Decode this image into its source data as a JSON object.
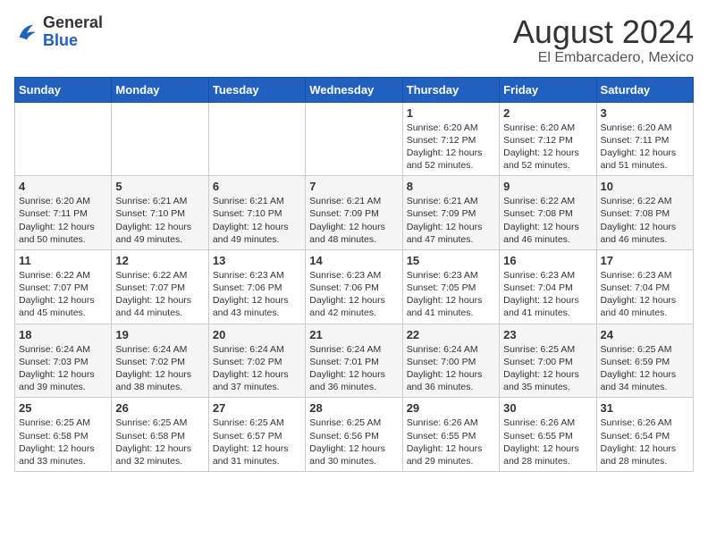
{
  "header": {
    "logo_general": "General",
    "logo_blue": "Blue",
    "month_year": "August 2024",
    "location": "El Embarcadero, Mexico"
  },
  "weekdays": [
    "Sunday",
    "Monday",
    "Tuesday",
    "Wednesday",
    "Thursday",
    "Friday",
    "Saturday"
  ],
  "weeks": [
    [
      {
        "day": "",
        "content": ""
      },
      {
        "day": "",
        "content": ""
      },
      {
        "day": "",
        "content": ""
      },
      {
        "day": "",
        "content": ""
      },
      {
        "day": "1",
        "content": "Sunrise: 6:20 AM\nSunset: 7:12 PM\nDaylight: 12 hours\nand 52 minutes."
      },
      {
        "day": "2",
        "content": "Sunrise: 6:20 AM\nSunset: 7:12 PM\nDaylight: 12 hours\nand 52 minutes."
      },
      {
        "day": "3",
        "content": "Sunrise: 6:20 AM\nSunset: 7:11 PM\nDaylight: 12 hours\nand 51 minutes."
      }
    ],
    [
      {
        "day": "4",
        "content": "Sunrise: 6:20 AM\nSunset: 7:11 PM\nDaylight: 12 hours\nand 50 minutes."
      },
      {
        "day": "5",
        "content": "Sunrise: 6:21 AM\nSunset: 7:10 PM\nDaylight: 12 hours\nand 49 minutes."
      },
      {
        "day": "6",
        "content": "Sunrise: 6:21 AM\nSunset: 7:10 PM\nDaylight: 12 hours\nand 49 minutes."
      },
      {
        "day": "7",
        "content": "Sunrise: 6:21 AM\nSunset: 7:09 PM\nDaylight: 12 hours\nand 48 minutes."
      },
      {
        "day": "8",
        "content": "Sunrise: 6:21 AM\nSunset: 7:09 PM\nDaylight: 12 hours\nand 47 minutes."
      },
      {
        "day": "9",
        "content": "Sunrise: 6:22 AM\nSunset: 7:08 PM\nDaylight: 12 hours\nand 46 minutes."
      },
      {
        "day": "10",
        "content": "Sunrise: 6:22 AM\nSunset: 7:08 PM\nDaylight: 12 hours\nand 46 minutes."
      }
    ],
    [
      {
        "day": "11",
        "content": "Sunrise: 6:22 AM\nSunset: 7:07 PM\nDaylight: 12 hours\nand 45 minutes."
      },
      {
        "day": "12",
        "content": "Sunrise: 6:22 AM\nSunset: 7:07 PM\nDaylight: 12 hours\nand 44 minutes."
      },
      {
        "day": "13",
        "content": "Sunrise: 6:23 AM\nSunset: 7:06 PM\nDaylight: 12 hours\nand 43 minutes."
      },
      {
        "day": "14",
        "content": "Sunrise: 6:23 AM\nSunset: 7:06 PM\nDaylight: 12 hours\nand 42 minutes."
      },
      {
        "day": "15",
        "content": "Sunrise: 6:23 AM\nSunset: 7:05 PM\nDaylight: 12 hours\nand 41 minutes."
      },
      {
        "day": "16",
        "content": "Sunrise: 6:23 AM\nSunset: 7:04 PM\nDaylight: 12 hours\nand 41 minutes."
      },
      {
        "day": "17",
        "content": "Sunrise: 6:23 AM\nSunset: 7:04 PM\nDaylight: 12 hours\nand 40 minutes."
      }
    ],
    [
      {
        "day": "18",
        "content": "Sunrise: 6:24 AM\nSunset: 7:03 PM\nDaylight: 12 hours\nand 39 minutes."
      },
      {
        "day": "19",
        "content": "Sunrise: 6:24 AM\nSunset: 7:02 PM\nDaylight: 12 hours\nand 38 minutes."
      },
      {
        "day": "20",
        "content": "Sunrise: 6:24 AM\nSunset: 7:02 PM\nDaylight: 12 hours\nand 37 minutes."
      },
      {
        "day": "21",
        "content": "Sunrise: 6:24 AM\nSunset: 7:01 PM\nDaylight: 12 hours\nand 36 minutes."
      },
      {
        "day": "22",
        "content": "Sunrise: 6:24 AM\nSunset: 7:00 PM\nDaylight: 12 hours\nand 36 minutes."
      },
      {
        "day": "23",
        "content": "Sunrise: 6:25 AM\nSunset: 7:00 PM\nDaylight: 12 hours\nand 35 minutes."
      },
      {
        "day": "24",
        "content": "Sunrise: 6:25 AM\nSunset: 6:59 PM\nDaylight: 12 hours\nand 34 minutes."
      }
    ],
    [
      {
        "day": "25",
        "content": "Sunrise: 6:25 AM\nSunset: 6:58 PM\nDaylight: 12 hours\nand 33 minutes."
      },
      {
        "day": "26",
        "content": "Sunrise: 6:25 AM\nSunset: 6:58 PM\nDaylight: 12 hours\nand 32 minutes."
      },
      {
        "day": "27",
        "content": "Sunrise: 6:25 AM\nSunset: 6:57 PM\nDaylight: 12 hours\nand 31 minutes."
      },
      {
        "day": "28",
        "content": "Sunrise: 6:25 AM\nSunset: 6:56 PM\nDaylight: 12 hours\nand 30 minutes."
      },
      {
        "day": "29",
        "content": "Sunrise: 6:26 AM\nSunset: 6:55 PM\nDaylight: 12 hours\nand 29 minutes."
      },
      {
        "day": "30",
        "content": "Sunrise: 6:26 AM\nSunset: 6:55 PM\nDaylight: 12 hours\nand 28 minutes."
      },
      {
        "day": "31",
        "content": "Sunrise: 6:26 AM\nSunset: 6:54 PM\nDaylight: 12 hours\nand 28 minutes."
      }
    ]
  ]
}
